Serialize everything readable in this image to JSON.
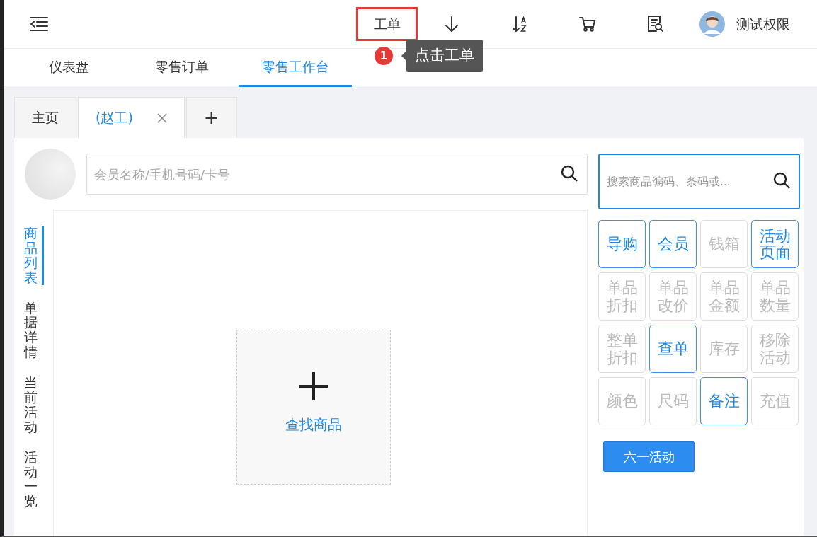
{
  "toolbar": {
    "work_order": {
      "label": "工单",
      "highlighted": true
    },
    "user": {
      "name": "测试权限"
    }
  },
  "callout": {
    "number": "1",
    "text": "点击工单"
  },
  "nav_tabs": [
    {
      "label": "仪表盘",
      "selected": false
    },
    {
      "label": "零售订单",
      "selected": false
    },
    {
      "label": "零售工作台",
      "selected": true
    }
  ],
  "page_tabs": [
    {
      "label": "主页",
      "selected": false,
      "closable": false
    },
    {
      "label": "(赵工)",
      "selected": true,
      "closable": true
    }
  ],
  "add_tab": "+",
  "member_search": {
    "placeholder": "会员名称/手机号码/卡号"
  },
  "side_tabs": [
    {
      "label": "商品列表",
      "selected": true
    },
    {
      "label": "单据详情",
      "selected": false
    },
    {
      "label": "当前活动",
      "selected": false
    },
    {
      "label": "活动一览",
      "selected": false
    }
  ],
  "find_product": {
    "label": "查找商品"
  },
  "product_search": {
    "placeholder": "搜索商品编码、条码或..."
  },
  "actions": [
    {
      "label": "导购",
      "disabled": false
    },
    {
      "label": "会员",
      "disabled": false
    },
    {
      "label": "钱箱",
      "disabled": true
    },
    {
      "label": "活动页面",
      "disabled": false
    },
    {
      "label": "单品折扣",
      "disabled": true
    },
    {
      "label": "单品改价",
      "disabled": true
    },
    {
      "label": "单品金额",
      "disabled": true
    },
    {
      "label": "单品数量",
      "disabled": true
    },
    {
      "label": "整单折扣",
      "disabled": true
    },
    {
      "label": "查单",
      "disabled": false
    },
    {
      "label": "库存",
      "disabled": true
    },
    {
      "label": "移除活动",
      "disabled": true
    },
    {
      "label": "颜色",
      "disabled": true
    },
    {
      "label": "尺码",
      "disabled": true
    },
    {
      "label": "备注",
      "disabled": false
    },
    {
      "label": "充值",
      "disabled": true
    }
  ],
  "promo_button": "六一活动"
}
